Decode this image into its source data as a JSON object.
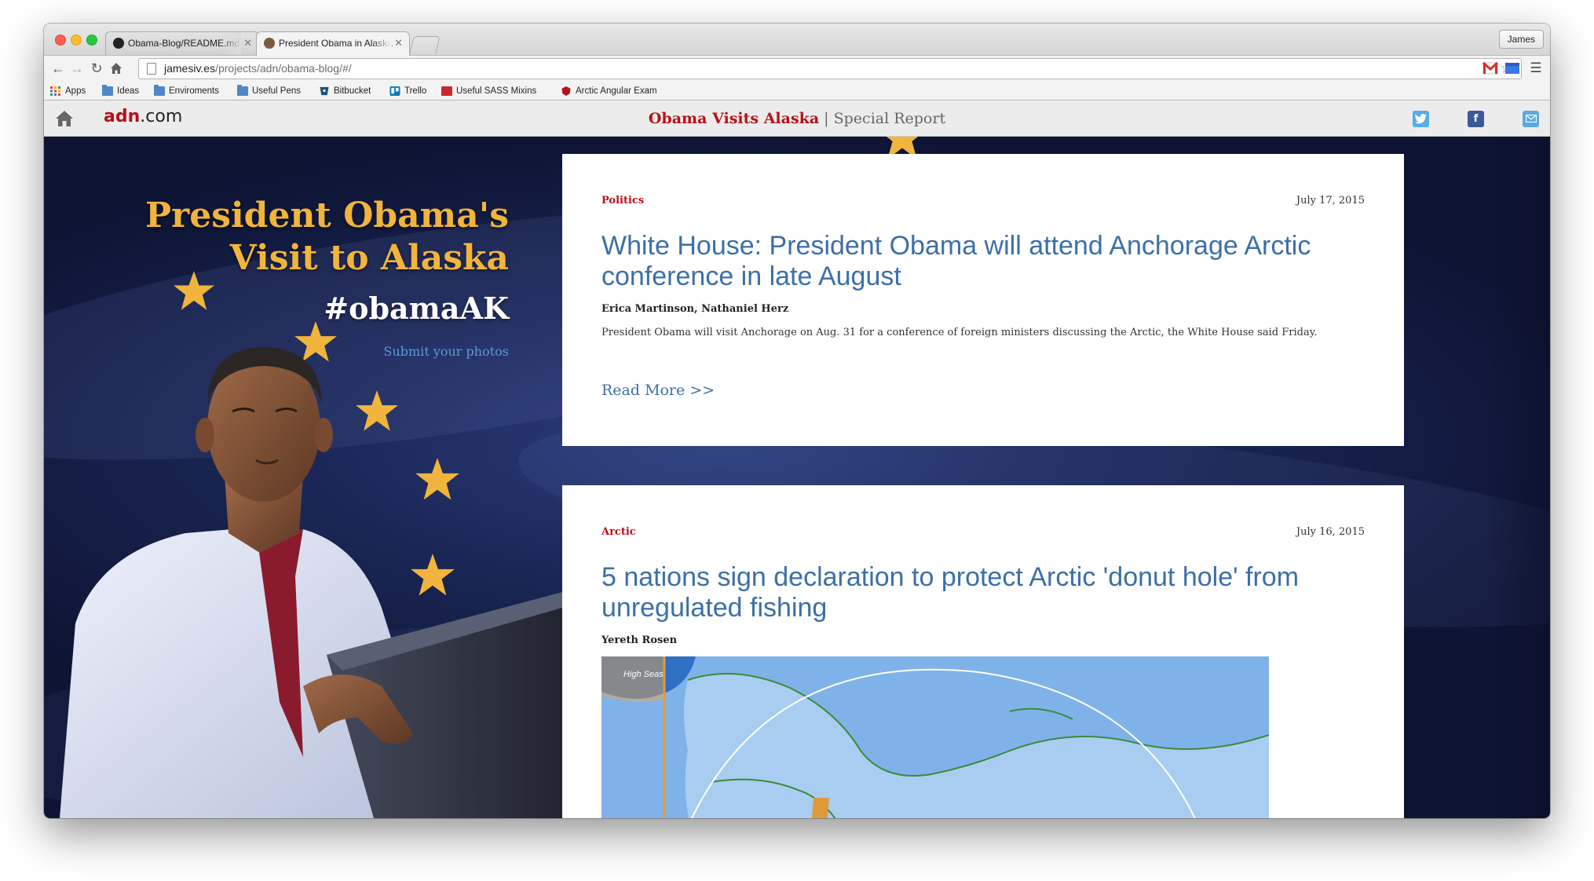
{
  "browser": {
    "tabs": [
      {
        "title": "Obama-Blog/README.md"
      },
      {
        "title": "President Obama in Alaska"
      }
    ],
    "profile_name": "James",
    "url": {
      "host": "jamesiv.es",
      "path": "/projects/adn/obama-blog/#/"
    },
    "bookmarks": [
      "Apps",
      "Ideas",
      "Enviroments",
      "Useful Pens",
      "Bitbucket",
      "Trello",
      "Useful SASS Mixins",
      "Arctic Angular Exam"
    ]
  },
  "site": {
    "logo_brand": "adn",
    "logo_suffix": ".com",
    "title_main": "Obama Visits Alaska",
    "title_sep": " | ",
    "title_sub": "Special Report",
    "social": [
      "twitter-icon",
      "facebook-icon",
      "email-icon"
    ]
  },
  "hero": {
    "title_line1": "President Obama's",
    "title_line2": "Visit to Alaska",
    "hashtag": "#obamaAK",
    "submit_link": "Submit your photos"
  },
  "posts": [
    {
      "category": "Politics",
      "date": "July 17, 2015",
      "headline": "White House: President Obama will attend Anchorage Arctic conference in late August",
      "authors": "Erica Martinson, Nathaniel Herz",
      "summary": "President Obama will visit Anchorage on Aug. 31 for a conference of foreign ministers discussing the Arctic, the White House said Friday.",
      "read_more": "Read More >>"
    },
    {
      "category": "Arctic",
      "date": "July 16, 2015",
      "headline": "5 nations sign declaration to protect Arctic 'donut hole' from unregulated fishing",
      "authors": "Yereth Rosen",
      "map_label": "High Seas"
    }
  ],
  "colors": {
    "brand_red": "#b5121b",
    "link_blue": "#3c6fa8",
    "star_gold": "#f1b43c",
    "flag_navy": "#1b2757"
  }
}
